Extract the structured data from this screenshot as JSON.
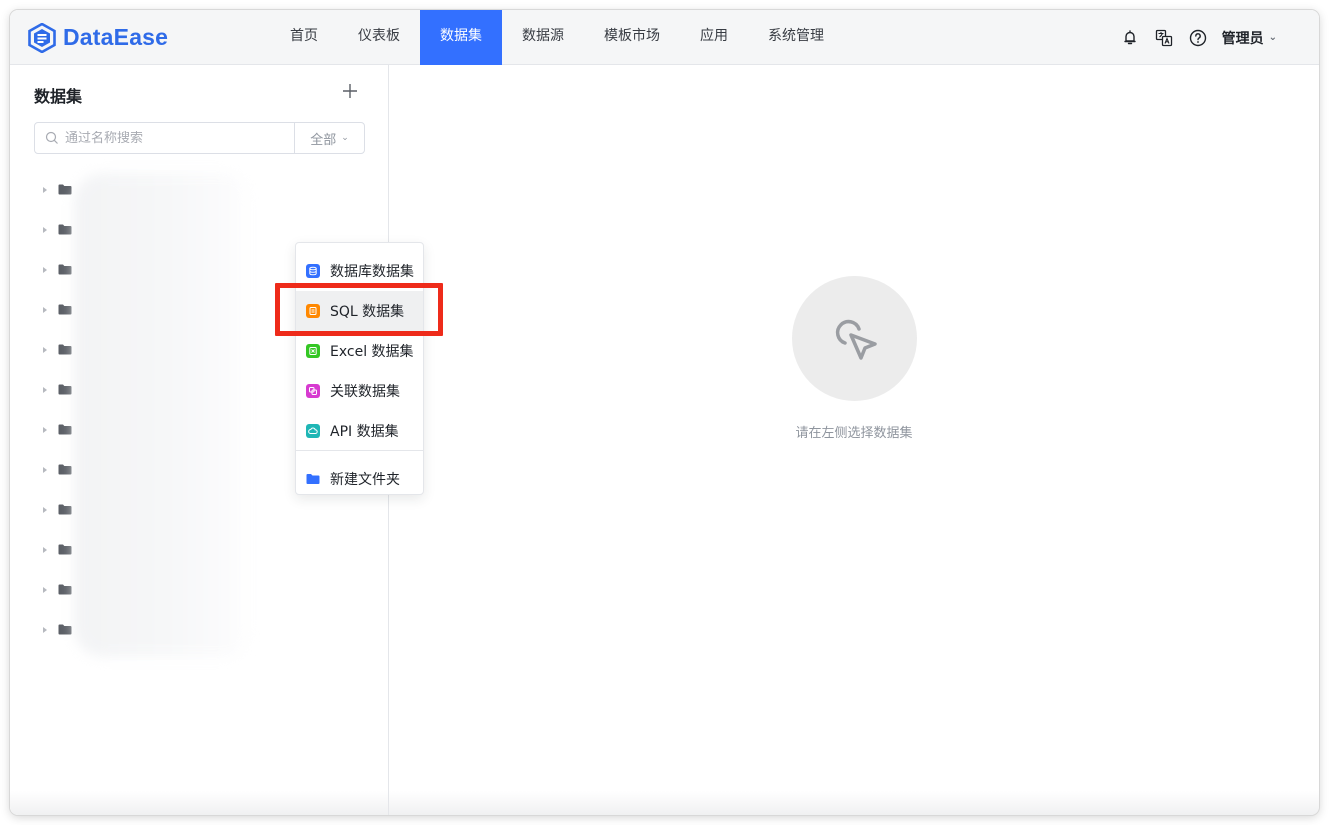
{
  "app": {
    "logo_text": "DataEase"
  },
  "nav": {
    "items": [
      {
        "label": "首页",
        "active": false
      },
      {
        "label": "仪表板",
        "active": false
      },
      {
        "label": "数据集",
        "active": true
      },
      {
        "label": "数据源",
        "active": false
      },
      {
        "label": "模板市场",
        "active": false
      },
      {
        "label": "应用",
        "active": false
      },
      {
        "label": "系统管理",
        "active": false
      }
    ]
  },
  "header_right": {
    "icons": [
      "notification-icon",
      "translate-icon",
      "help-icon"
    ],
    "user_label": "管理员"
  },
  "sidebar": {
    "title": "数据集",
    "search": {
      "placeholder": "通过名称搜索",
      "value": "",
      "filter_label": "全部"
    },
    "tree_row_count": 12
  },
  "menu": {
    "items": [
      {
        "label": "数据库数据集",
        "icon": "database-icon",
        "color": "#3370ff"
      },
      {
        "label": "SQL 数据集",
        "icon": "sql-icon",
        "color": "#ff8800",
        "hover": true
      },
      {
        "label": "Excel 数据集",
        "icon": "excel-icon",
        "color": "#34c724"
      },
      {
        "label": "关联数据集",
        "icon": "link-icon",
        "color": "#d73ad0"
      },
      {
        "label": "API 数据集",
        "icon": "api-icon",
        "color": "#1fb6b5"
      }
    ],
    "folder_item": {
      "label": "新建文件夹",
      "icon": "folder-icon",
      "color": "#3370ff"
    }
  },
  "empty_state": {
    "text": "请在左侧选择数据集"
  },
  "colors": {
    "primary": "#3370ff",
    "highlight_box": "#ee2b1a"
  }
}
